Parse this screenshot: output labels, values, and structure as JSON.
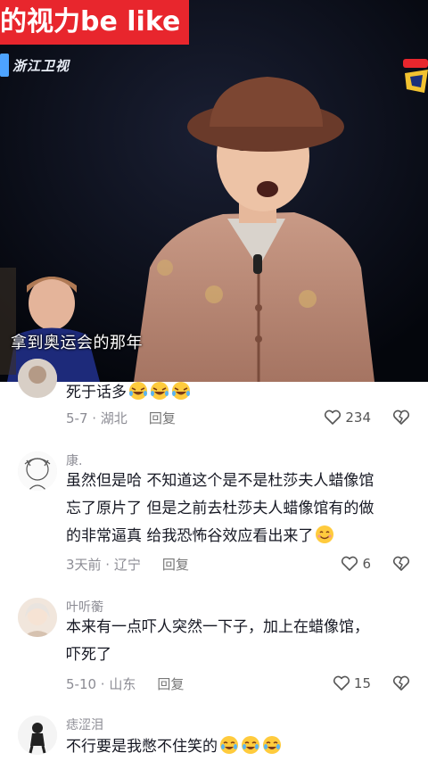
{
  "video": {
    "banner_text": "的视力be like",
    "station_logo": "浙江卫视",
    "subtitle": "拿到奥运会的那年"
  },
  "comments": [
    {
      "username": "",
      "text": "死于话多",
      "emoji": [
        "rolling-laughing-emoji",
        "rolling-laughing-emoji",
        "rolling-laughing-emoji"
      ],
      "date": "5-7 · 湖北",
      "reply_label": "回复",
      "likes": "234"
    },
    {
      "username": "康.",
      "text_lines": [
        "虽然但是哈 不知道这个是不是杜莎夫人蜡像馆",
        "忘了原片了 但是之前去杜莎夫人蜡像馆有的做",
        "的非常逼真 给我恐怖谷效应看出来了"
      ],
      "emoji": [
        "smile-emoji"
      ],
      "date": "3天前 · 辽宁",
      "reply_label": "回复",
      "likes": "6"
    },
    {
      "username": "叶听蘅",
      "text_lines": [
        "本来有一点吓人突然一下子，加上在蜡像馆，",
        "吓死了"
      ],
      "date": "5-10 · 山东",
      "reply_label": "回复",
      "likes": "15"
    },
    {
      "username": "痣涩泪",
      "text": "不行要是我憋不住笑的",
      "emoji": [
        "tears-of-joy-emoji",
        "tears-of-joy-emoji",
        "tears-of-joy-emoji"
      ]
    }
  ],
  "colors": {
    "banner": "#e8262d",
    "text": "#161823",
    "muted": "#8c8c94"
  }
}
